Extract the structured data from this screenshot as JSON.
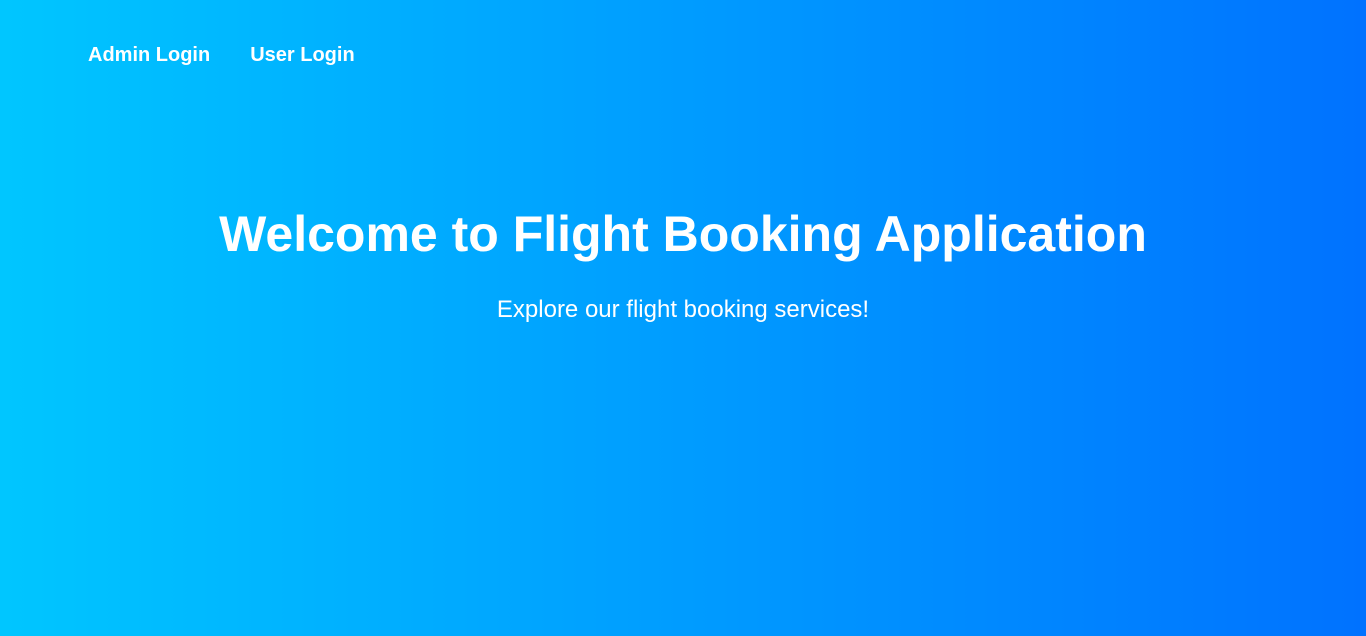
{
  "nav": {
    "items": [
      {
        "label": "Admin Login"
      },
      {
        "label": "User Login"
      }
    ]
  },
  "hero": {
    "title": "Welcome to Flight Booking Application",
    "subtitle": "Explore our flight booking services!"
  },
  "colors": {
    "gradient_start": "#00c6ff",
    "gradient_end": "#0072ff",
    "text": "#ffffff"
  }
}
